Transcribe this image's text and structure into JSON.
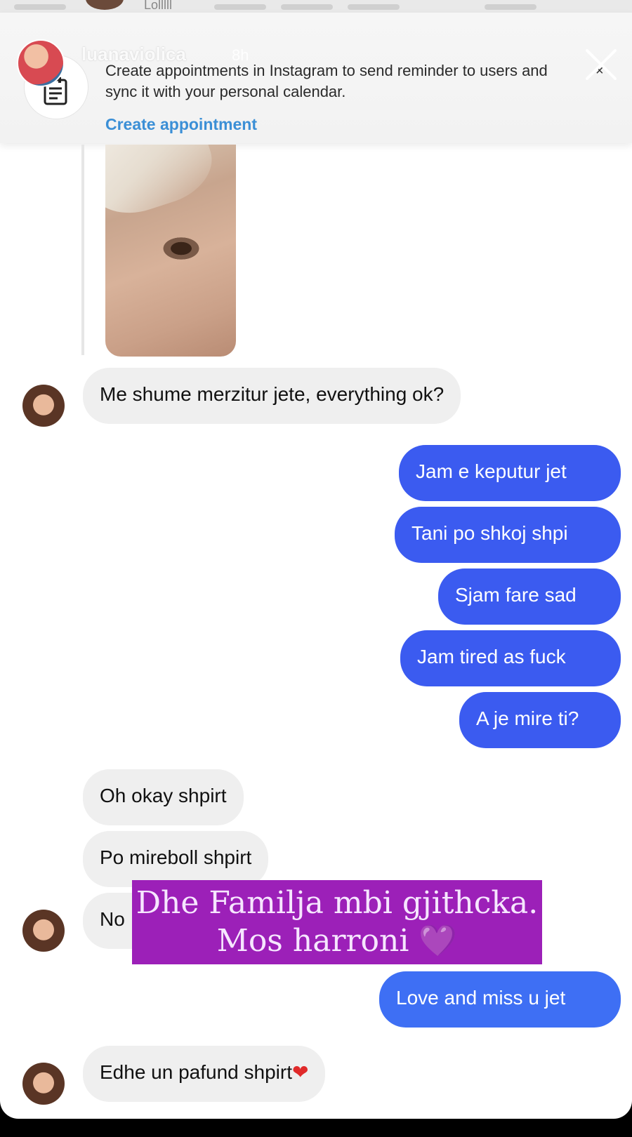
{
  "story": {
    "username": "luanaviolica",
    "time": "8h",
    "top_caption": "Lolllll"
  },
  "banner": {
    "text": "Create appointments in Instagram to send reminder to users and sync it with your personal calendar.",
    "link": "Create appointment",
    "close_small": "×"
  },
  "messages": [
    {
      "side": "in",
      "text": "Me shume merzitur jete, everything ok?"
    },
    {
      "side": "out",
      "text": "Jam e keputur jet"
    },
    {
      "side": "out",
      "text": "Tani po shkoj shpi"
    },
    {
      "side": "out",
      "text": "Sjam fare sad"
    },
    {
      "side": "out",
      "text": "Jam tired as fuck"
    },
    {
      "side": "out",
      "text": "A je mire ti?"
    },
    {
      "side": "in",
      "text": "Oh okay shpirt"
    },
    {
      "side": "in",
      "text": "Po mireboll shpirt"
    },
    {
      "side": "in",
      "text": "No"
    },
    {
      "side": "out",
      "text": "Love and miss u jet"
    },
    {
      "side": "in",
      "text": "Edhe un pafund shpirt"
    }
  ],
  "overlay": {
    "line1": "Dhe Familja mbi gjithcka.",
    "line2": "Mos harroni",
    "emoji_heart": "💜"
  },
  "emoji": {
    "red_heart": "❤"
  },
  "colors": {
    "outgoing_bubble": "#3b5bf0",
    "incoming_bubble": "#efefef",
    "overlay_bg": "#9c20b8",
    "link": "#3b8fd6"
  }
}
